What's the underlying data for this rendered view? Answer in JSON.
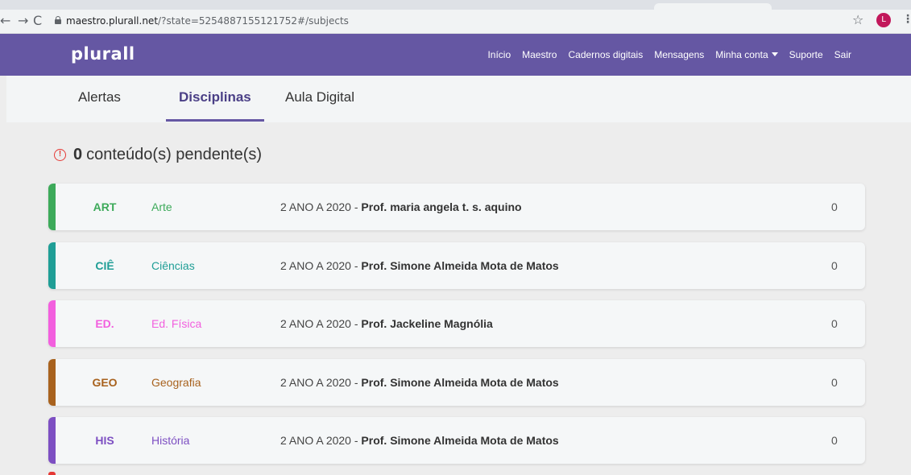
{
  "browser": {
    "url_host": "maestro.plurall.net",
    "url_path": "/?state=5254887155121752#/subjects",
    "profile_initial": "L"
  },
  "header": {
    "logo": "plurall",
    "nav": [
      {
        "label": "Início"
      },
      {
        "label": "Maestro"
      },
      {
        "label": "Cadernos digitais"
      },
      {
        "label": "Mensagens"
      },
      {
        "label": "Minha conta"
      },
      {
        "label": "Suporte"
      },
      {
        "label": "Sair"
      }
    ]
  },
  "tabs": [
    {
      "label": "Alertas",
      "active": false
    },
    {
      "label": "Disciplinas",
      "active": true
    },
    {
      "label": "Aula Digital",
      "active": false
    }
  ],
  "pending": {
    "count": "0",
    "label": "conteúdo(s) pendente(s)"
  },
  "subjects": [
    {
      "code": "ART",
      "name": "Arte",
      "class": "2 ANO A 2020",
      "separator": " - ",
      "teacher": "Prof. maria angela t. s. aquino",
      "count": "0",
      "color": "#3daa5a"
    },
    {
      "code": "CIÊ",
      "name": "Ciências",
      "class": "2 ANO A 2020",
      "separator": " - ",
      "teacher": "Prof. Simone Almeida Mota de Matos",
      "count": "0",
      "color": "#1f9e96"
    },
    {
      "code": "ED.",
      "name": "Ed. Física",
      "class": "2 ANO A 2020",
      "separator": " - ",
      "teacher": "Prof. Jackeline Magnólia",
      "count": "0",
      "color": "#f25fde"
    },
    {
      "code": "GEO",
      "name": "Geografia",
      "class": "2 ANO A 2020",
      "separator": " - ",
      "teacher": "Prof. Simone Almeida Mota de Matos",
      "count": "0",
      "color": "#a8621e"
    },
    {
      "code": "HIS",
      "name": "História",
      "class": "2 ANO A 2020",
      "separator": " - ",
      "teacher": "Prof. Simone Almeida Mota de Matos",
      "count": "0",
      "color": "#7d4fc2"
    }
  ],
  "colors": {
    "header_bg": "#6557a3",
    "warning": "#e53935"
  }
}
